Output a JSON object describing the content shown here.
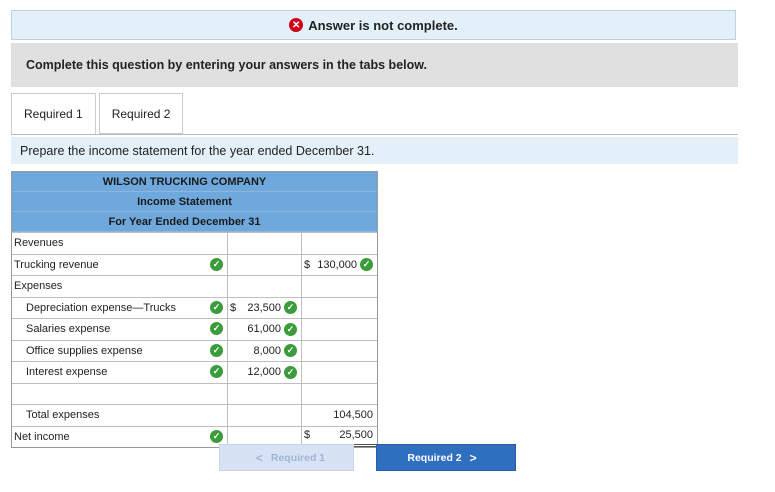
{
  "banner": {
    "text": "Answer is not complete."
  },
  "instructions": "Complete this question by entering your answers in the tabs below.",
  "tabs": [
    {
      "label": "Required 1"
    },
    {
      "label": "Required 2"
    }
  ],
  "prompt": "Prepare the income statement for the year ended December 31.",
  "statement": {
    "company": "WILSON TRUCKING COMPANY",
    "title": "Income Statement",
    "period": "For Year Ended December 31",
    "rows": {
      "revenues": "Revenues",
      "trucking_revenue": {
        "label": "Trucking revenue",
        "amount": "130,000"
      },
      "expenses": "Expenses",
      "depreciation": {
        "label": "Depreciation expense—Trucks",
        "amount": "23,500"
      },
      "salaries": {
        "label": "Salaries expense",
        "amount": "61,000"
      },
      "office": {
        "label": "Office supplies expense",
        "amount": "8,000"
      },
      "interest": {
        "label": "Interest expense",
        "amount": "12,000"
      },
      "total_expenses": {
        "label": "Total expenses",
        "amount": "104,500"
      },
      "net_income": {
        "label": "Net income",
        "amount": "25,500"
      }
    },
    "currency": "$"
  },
  "nav": {
    "prev_label": "Required 1",
    "next_label": "Required 2",
    "prev_arrow": "<",
    "next_arrow": ">"
  },
  "colors": {
    "header_blue": "#6fa8dc",
    "correct_green": "#3a9c3a",
    "error_red": "#d0021b",
    "button_blue": "#2f6fbf"
  }
}
